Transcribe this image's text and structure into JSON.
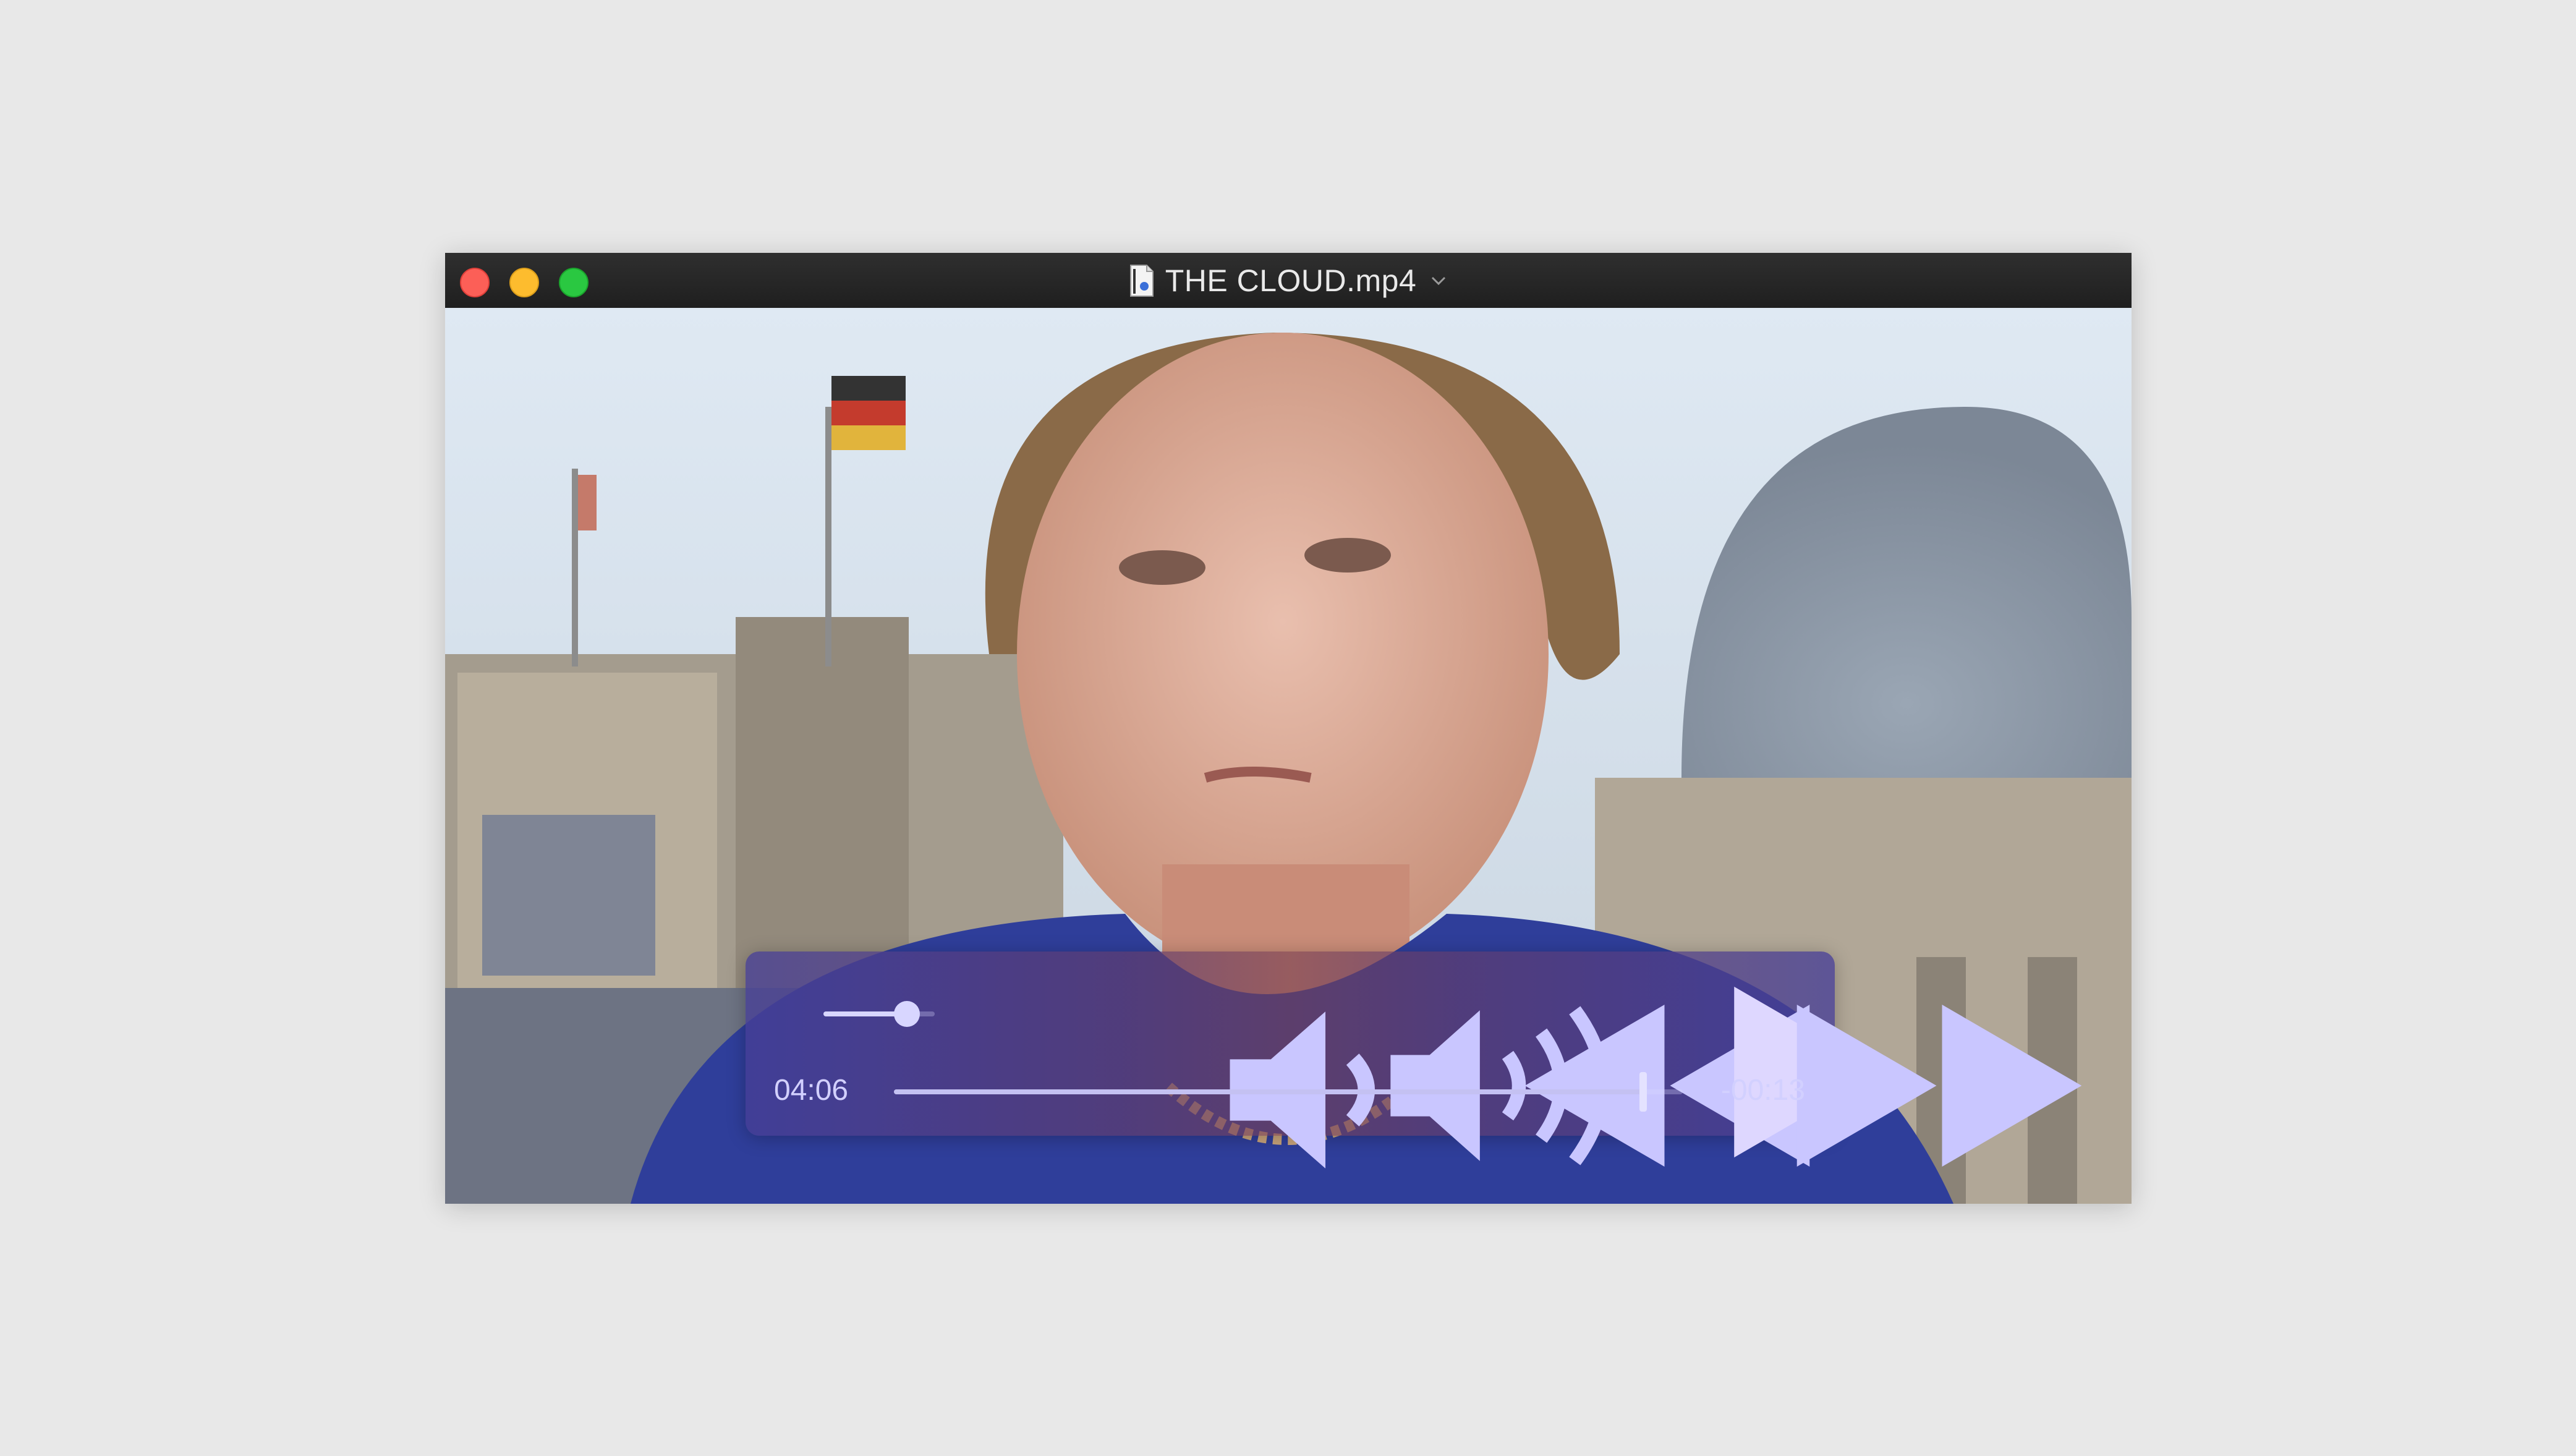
{
  "window": {
    "title": "THE CLOUD.mp4",
    "buttons": [
      "close",
      "minimize",
      "zoom"
    ]
  },
  "player": {
    "elapsed": "04:06",
    "remaining": "-00:13",
    "progress_fraction": 0.95,
    "volume_fraction": 0.75,
    "icons": [
      "volume-low-icon",
      "volume-high-icon",
      "rewind-icon",
      "play-icon",
      "fast-forward-icon",
      "share-icon"
    ]
  },
  "colors": {
    "close": "#fc5f57",
    "minimize": "#fdbc2e",
    "zoom": "#2ac841",
    "controls_tint": "#5a4fb0"
  }
}
